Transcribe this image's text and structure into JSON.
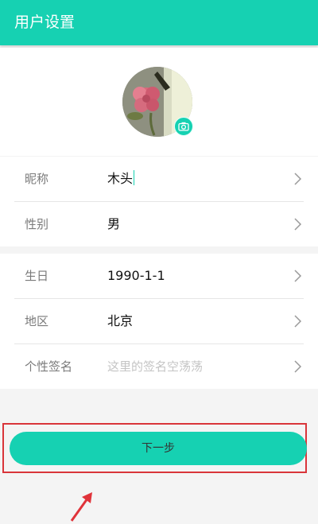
{
  "header": {
    "title": "用户设置"
  },
  "profile": {
    "avatar_icon": "flower-photo",
    "camera_icon": "camera-icon"
  },
  "basic": {
    "nickname": {
      "label": "昵称",
      "value": "木头"
    },
    "gender": {
      "label": "性别",
      "value": "男"
    }
  },
  "details": {
    "birthday": {
      "label": "生日",
      "value": "1990-1-1"
    },
    "region": {
      "label": "地区",
      "value": "北京"
    },
    "signature": {
      "label": "个性签名",
      "placeholder": "这里的签名空荡荡"
    }
  },
  "actions": {
    "next_label": "下一步"
  },
  "colors": {
    "accent": "#16d1b2",
    "highlight": "#d9353a",
    "background": "#f4f4f4"
  }
}
